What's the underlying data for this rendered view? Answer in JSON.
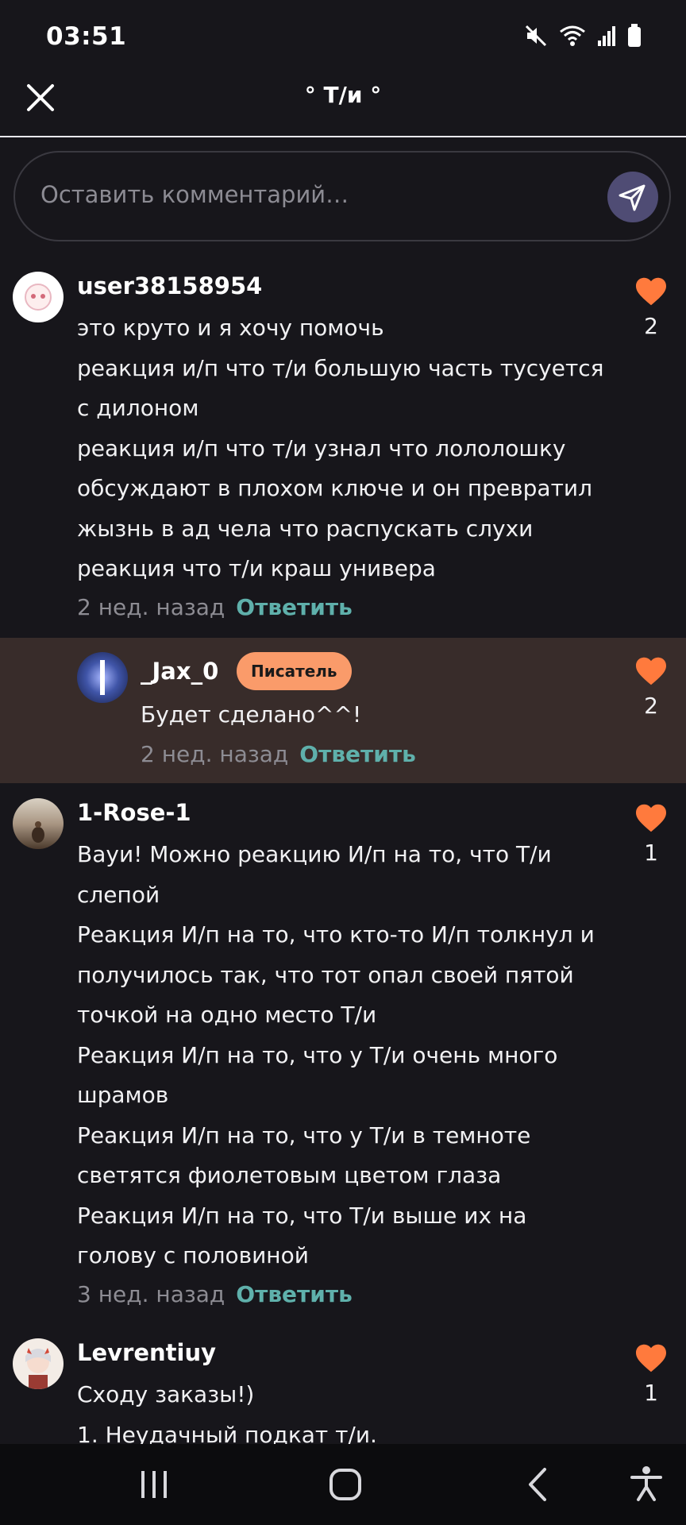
{
  "status_bar": {
    "time": "03:51"
  },
  "header": {
    "title": "° Т/и °"
  },
  "comment_box": {
    "placeholder": "Оставить комментарий…"
  },
  "colors": {
    "accent_heart": "#ff7a3d",
    "reply_link": "#5fb0ab",
    "writer_badge": "#fa9b6a",
    "highlight_bg": "#382c2a"
  },
  "comments": [
    {
      "username": "user38158954",
      "lines": [
        "это круто и я хочу помочь",
        "реакция и/п что т/и большую часть тусуется",
        "с дилоном",
        "реакция и/п что т/и узнал что лололошку",
        "обсуждают в плохом ключе и он превратил",
        "жызнь в ад чела что распускать слухи",
        "реакция что т/и краш универа"
      ],
      "time": "2 нед. назад",
      "reply": "Ответить",
      "likes": "2"
    },
    {
      "username": "_Jax_0",
      "badge": "Писатель",
      "lines": [
        "Будет сделано^^!"
      ],
      "time": "2 нед. назад",
      "reply": "Ответить",
      "likes": "2"
    },
    {
      "username": "1-Rose-1",
      "lines": [
        "Вауи! Можно реакцию И/п на то, что Т/и",
        "слепой",
        "Реакция И/п на то, что кто-то И/п толкнул и",
        "получилось так, что тот опал своей пятой",
        "точкой на одно место Т/и",
        "Реакция И/п на то, что у Т/и очень много",
        "шрамов",
        "Реакция И/п на то, что у Т/и в темноте",
        "светятся фиолетовым цветом глаза",
        "Реакция И/п на то, что Т/и выше их на",
        "голову с половиной"
      ],
      "time": "3 нед. назад",
      "reply": "Ответить",
      "likes": "1"
    },
    {
      "username": "Levrentiuy",
      "lines": [
        "Сходу заказы!)",
        "1. Неудачный подкат т/и."
      ],
      "likes": "1"
    }
  ]
}
